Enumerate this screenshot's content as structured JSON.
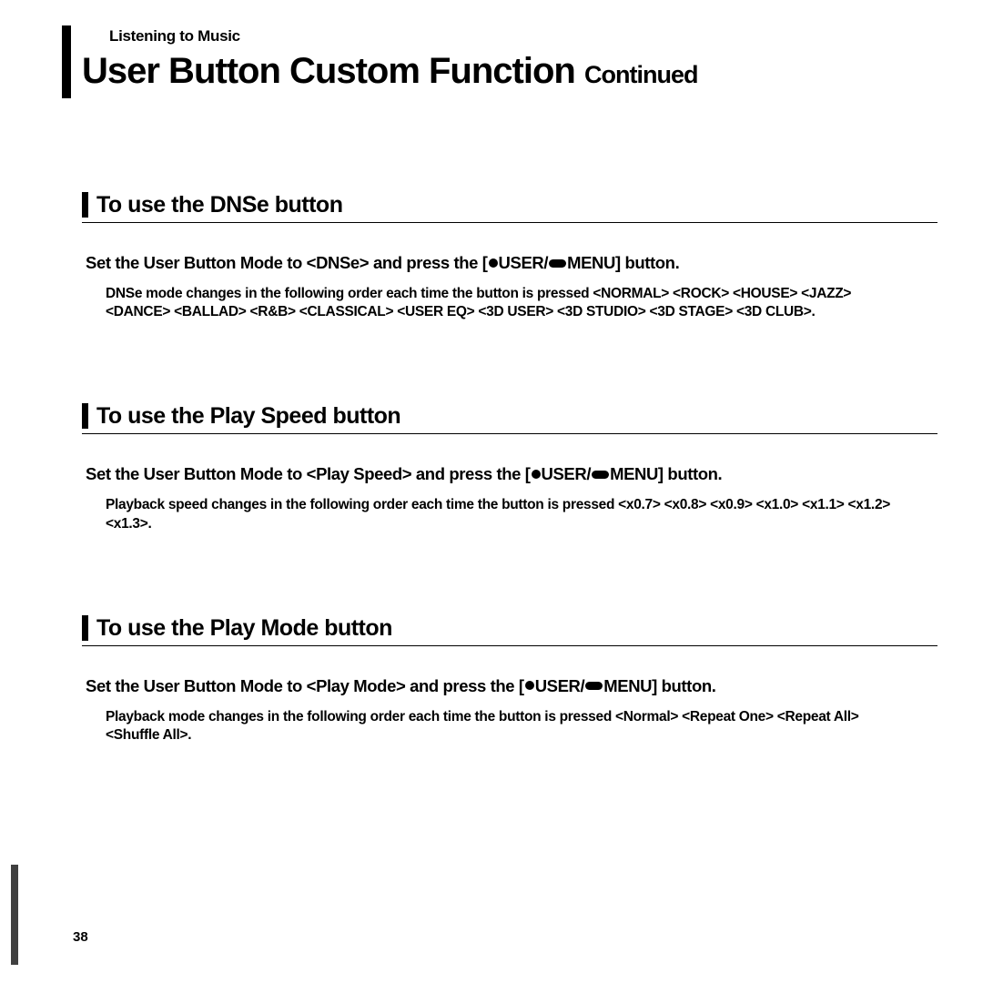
{
  "chapter": "Listening to Music",
  "title_main": "User Button Custom Function",
  "title_continued": "Continued",
  "page_number": "38",
  "sections": [
    {
      "title": "To use the DNSe button",
      "intro_pre": "Set the User Button Mode to <DNSe> and press the [",
      "intro_mid": "USER/",
      "intro_post": "MENU] button.",
      "detail": "DNSe mode changes in the following order each time the button is pressed <NORMAL> <ROCK> <HOUSE> <JAZZ> <DANCE> <BALLAD> <R&B> <CLASSICAL> <USER EQ> <3D USER> <3D STUDIO> <3D STAGE> <3D CLUB>."
    },
    {
      "title": "To use the Play Speed button",
      "intro_pre": "Set the User Button Mode to <Play Speed> and press the [",
      "intro_mid": "USER/",
      "intro_post": "MENU] button.",
      "detail": "Playback speed changes in the following order each time the button is pressed <x0.7> <x0.8> <x0.9> <x1.0> <x1.1> <x1.2> <x1.3>."
    },
    {
      "title": "To use the Play Mode button",
      "intro_pre": "Set the User Button Mode to <Play Mode> and press the [",
      "intro_mid": "USER/",
      "intro_post": "MENU] button.",
      "detail": "Playback mode changes in the following order each time the button is pressed <Normal> <Repeat One> <Repeat All> <Shuffle All>."
    }
  ]
}
